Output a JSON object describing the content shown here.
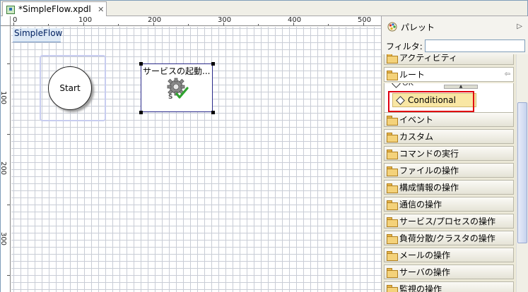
{
  "tab": {
    "title": "*SimpleFlow.xpdl",
    "close": "✕"
  },
  "ruler": {
    "top": [
      "0",
      "100",
      "200",
      "300",
      "400",
      "500"
    ],
    "left": [
      "100",
      "200",
      "300"
    ]
  },
  "canvas": {
    "flow_title": "SimpleFlow",
    "start_label": "Start",
    "service_label": "サービスの起動..."
  },
  "palette": {
    "title": "パレット",
    "filter_label": "フィルタ:",
    "filter_value": "",
    "drawers": [
      "アクティビティ",
      "ルート",
      "イベント",
      "カスタム",
      "コマンドの実行",
      "ファイルの操作",
      "構成情報の操作",
      "通信の操作",
      "サービス/プロセスの操作",
      "負荷分散/クラスタの操作",
      "メールの操作",
      "サーバの操作",
      "監視の操作"
    ],
    "route_items": {
      "ok": "OK",
      "conditional": "Conditional"
    }
  }
}
